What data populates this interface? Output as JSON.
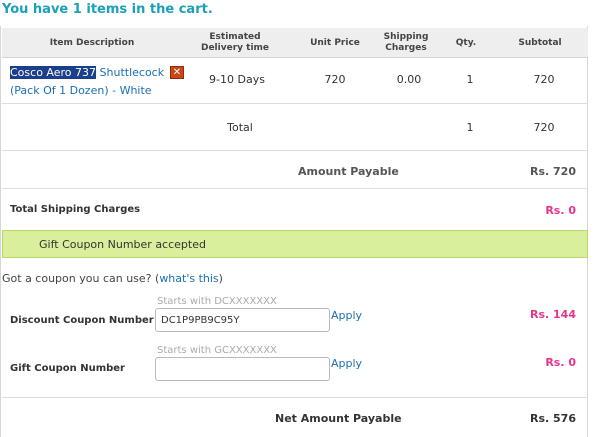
{
  "cart": {
    "prefix": "You have",
    "count": "1",
    "suffix": "items in the cart."
  },
  "table": {
    "headers": {
      "item_description": "Item Description",
      "delivery": "Estimated Delivery time",
      "unit_price": "Unit Price",
      "shipping": "Shipping Charges",
      "qty": "Qty.",
      "subtotal": "Subtotal"
    },
    "item": {
      "name_selected": "Cosco Aero 737",
      "name_rest": "Shuttlecock (Pack Of 1 Dozen) - White",
      "remove_icon": "close-icon",
      "delivery": "9-10 Days",
      "unit_price": "720",
      "shipping": "0.00",
      "qty": "1",
      "subtotal": "720"
    },
    "total": {
      "label": "Total",
      "qty": "1",
      "subtotal": "720"
    }
  },
  "summary": {
    "amount_payable_label": "Amount Payable",
    "amount_payable_value": "Rs. 720",
    "shipping_label": "Total Shipping Charges",
    "shipping_value": "Rs. 0",
    "coupon_success": "Gift Coupon Number accepted",
    "net_label": "Net Amount Payable",
    "net_value": "Rs. 576"
  },
  "coupons": {
    "question": "Got a coupon you can use?",
    "whats_this": "what's this",
    "discount": {
      "label": "Discount Coupon Number",
      "hint": "Starts with DCXXXXXXX",
      "value": "DC1P9PB9C95Y",
      "apply": "Apply",
      "amount": "Rs. 144"
    },
    "gift": {
      "label": "Gift Coupon Number",
      "hint": "Starts with GCXXXXXXX",
      "value": "",
      "apply": "Apply",
      "amount": "Rs. 0"
    }
  },
  "colors": {
    "heading": "#1aa0b8",
    "link": "#1a6fb3",
    "pink": "#e8348b",
    "success_bg": "#d9ef9b"
  }
}
